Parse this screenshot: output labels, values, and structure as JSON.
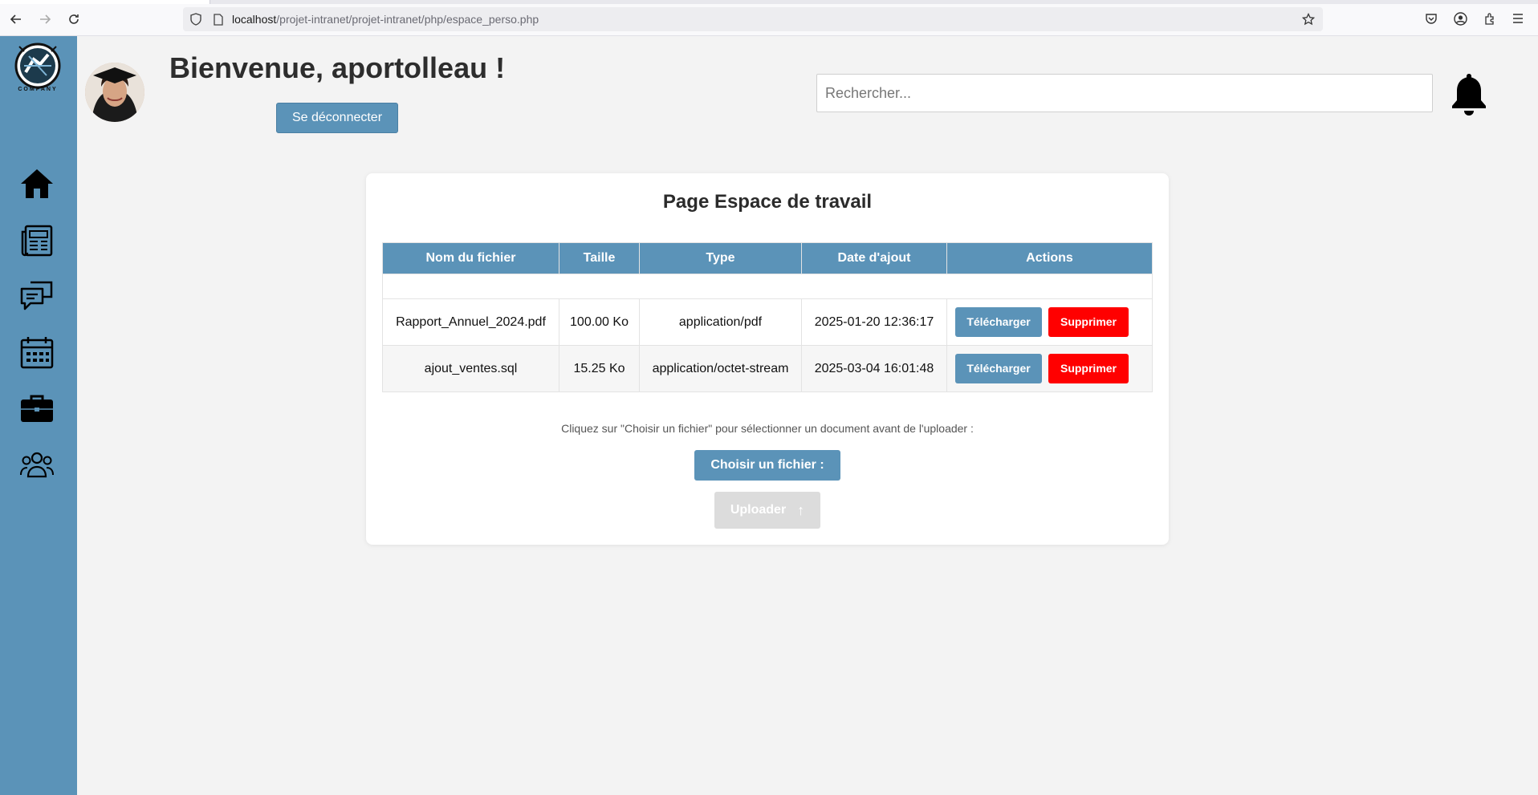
{
  "browser": {
    "url_host": "localhost",
    "url_path": "/projet-intranet/projet-intranet/php/espace_perso.php"
  },
  "sidebar": {
    "logo_text": "COMPANY",
    "items": [
      {
        "icon": "home-icon"
      },
      {
        "icon": "newspaper-icon"
      },
      {
        "icon": "chat-icon"
      },
      {
        "icon": "calendar-icon"
      },
      {
        "icon": "briefcase-icon"
      },
      {
        "icon": "users-icon"
      }
    ]
  },
  "header": {
    "welcome": "Bienvenue, aportolleau !",
    "logout_label": "Se déconnecter",
    "search_placeholder": "Rechercher..."
  },
  "workspace": {
    "title": "Page Espace de travail",
    "columns": [
      "Nom du fichier",
      "Taille",
      "Type",
      "Date d'ajout",
      "Actions"
    ],
    "rows": [
      {
        "name": "Rapport_Annuel_2024.pdf",
        "size": "100.00 Ko",
        "type": "application/pdf",
        "date": "2025-01-20 12:36:17",
        "download": "Télécharger",
        "delete": "Supprimer"
      },
      {
        "name": "ajout_ventes.sql",
        "size": "15.25 Ko",
        "type": "application/octet-stream",
        "date": "2025-03-04 16:01:48",
        "download": "Télécharger",
        "delete": "Supprimer"
      }
    ],
    "hint": "Cliquez sur \"Choisir un fichier\" pour sélectionner un document avant de l'uploader :",
    "choose_label": "Choisir un fichier :",
    "upload_label": "Uploader",
    "upload_arrow": "↑"
  },
  "colors": {
    "accent": "#5b93b8",
    "danger": "#ff0000",
    "disabled": "#dcdcdc"
  }
}
